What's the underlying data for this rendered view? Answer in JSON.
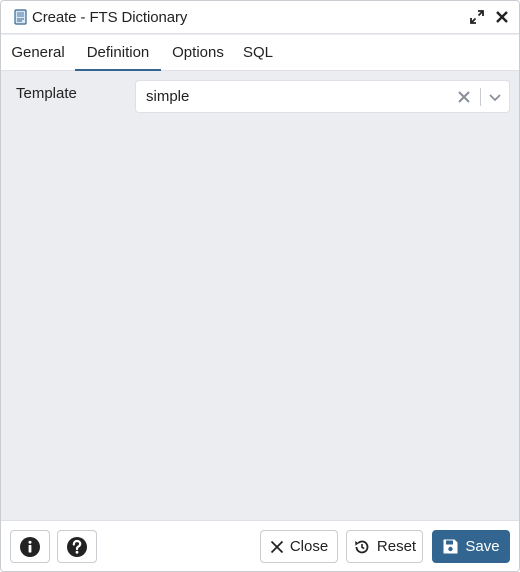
{
  "dialog": {
    "title": "Create - FTS Dictionary",
    "icons": {
      "title": "dictionary-icon",
      "expand": "expand-icon",
      "close": "close-icon"
    }
  },
  "tabs": [
    {
      "label": "General",
      "active": false
    },
    {
      "label": "Definition",
      "active": true
    },
    {
      "label": "Options",
      "active": false
    },
    {
      "label": "SQL",
      "active": false
    }
  ],
  "form": {
    "template": {
      "label": "Template",
      "value": "simple"
    }
  },
  "footer": {
    "info_icon": "info-icon",
    "help_icon": "help-icon",
    "close_label": "Close",
    "reset_label": "Reset",
    "save_label": "Save"
  },
  "colors": {
    "accent": "#326690",
    "panel_bg": "#ebedf0",
    "border": "#dde0e6"
  }
}
